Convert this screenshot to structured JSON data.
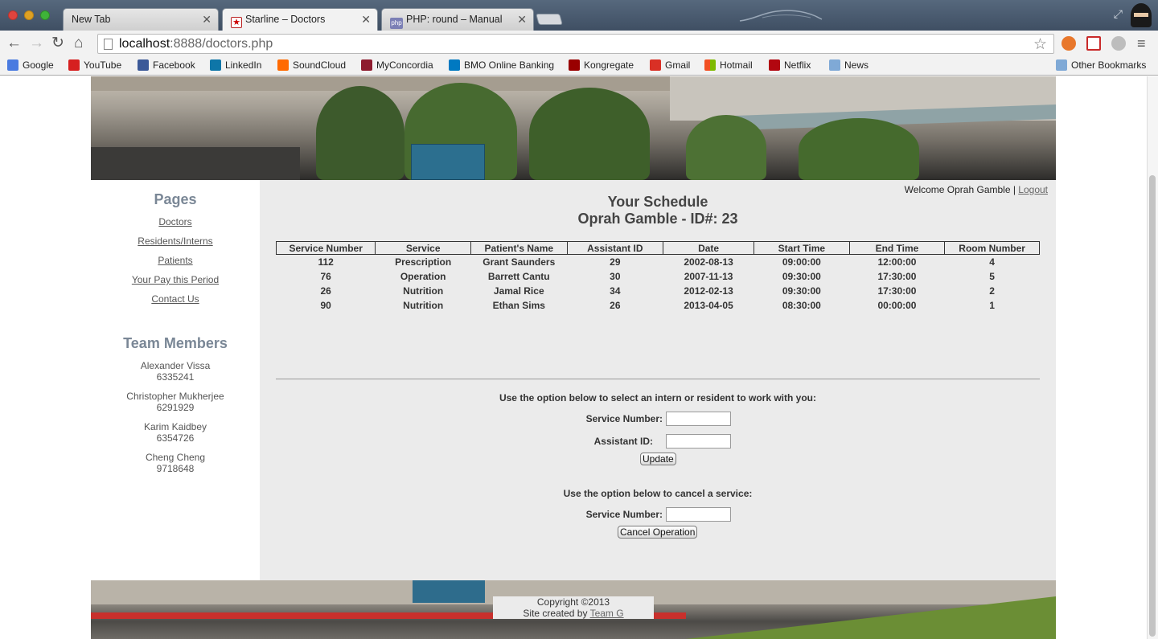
{
  "browser": {
    "tabs": [
      {
        "title": "New Tab",
        "active": false
      },
      {
        "title": "Starline – Doctors",
        "active": true
      },
      {
        "title": "PHP: round – Manual",
        "active": false
      }
    ],
    "url_host": "localhost",
    "url_rest": ":8888/doctors.php",
    "bookmarks": [
      {
        "label": "Google",
        "color": "#4a7be0"
      },
      {
        "label": "YouTube",
        "color": "#d62020"
      },
      {
        "label": "Facebook",
        "color": "#3b5998"
      },
      {
        "label": "LinkedIn",
        "color": "#0e76a8"
      },
      {
        "label": "SoundCloud",
        "color": "#ff6a00"
      },
      {
        "label": "MyConcordia",
        "color": "#8e1b2e"
      },
      {
        "label": "BMO Online Banking",
        "color": "#0079c1"
      },
      {
        "label": "Kongregate",
        "color": "#990000"
      },
      {
        "label": "Gmail",
        "color": "#d93025"
      },
      {
        "label": "Hotmail",
        "color": "#f25022"
      },
      {
        "label": "Netflix",
        "color": "#b20710"
      },
      {
        "label": "News",
        "color": "#7fa9d6"
      }
    ],
    "other_bookmarks": "Other Bookmarks"
  },
  "sidebar": {
    "pages_heading": "Pages",
    "links": [
      "Doctors",
      "Residents/Interns",
      "Patients",
      "Your Pay this Period",
      "Contact Us"
    ],
    "team_heading": "Team Members",
    "members": [
      {
        "name": "Alexander Vissa",
        "id": "6335241"
      },
      {
        "name": "Christopher Mukherjee",
        "id": "6291929"
      },
      {
        "name": "Karim Kaidbey",
        "id": "6354726"
      },
      {
        "name": "Cheng Cheng",
        "id": "9718648"
      }
    ]
  },
  "main": {
    "welcome": "Welcome Oprah Gamble |",
    "logout": "Logout",
    "title": "Your Schedule",
    "subtitle": "Oprah Gamble - ID#: 23",
    "table": {
      "headers": [
        "Service Number",
        "Service",
        "Patient's Name",
        "Assistant ID",
        "Date",
        "Start Time",
        "End Time",
        "Room Number"
      ],
      "rows": [
        [
          "112",
          "Prescription",
          "Grant Saunders",
          "29",
          "2002-08-13",
          "09:00:00",
          "12:00:00",
          "4"
        ],
        [
          "76",
          "Operation",
          "Barrett Cantu",
          "30",
          "2007-11-13",
          "09:30:00",
          "17:30:00",
          "5"
        ],
        [
          "26",
          "Nutrition",
          "Jamal Rice",
          "34",
          "2012-02-13",
          "09:30:00",
          "17:30:00",
          "2"
        ],
        [
          "90",
          "Nutrition",
          "Ethan Sims",
          "26",
          "2013-04-05",
          "08:30:00",
          "00:00:00",
          "1"
        ]
      ]
    },
    "assign_form": {
      "prompt": "Use the option below to select an intern or resident to work with you:",
      "service_label": "Service Number:",
      "assistant_label": "Assistant ID:",
      "button": "Update"
    },
    "cancel_form": {
      "prompt": "Use the option below to cancel a service:",
      "service_label": "Service Number:",
      "button": "Cancel Operation"
    }
  },
  "footer": {
    "copyright": "Copyright ©2013",
    "created_by": "Site created by",
    "team_link": "Team G"
  }
}
